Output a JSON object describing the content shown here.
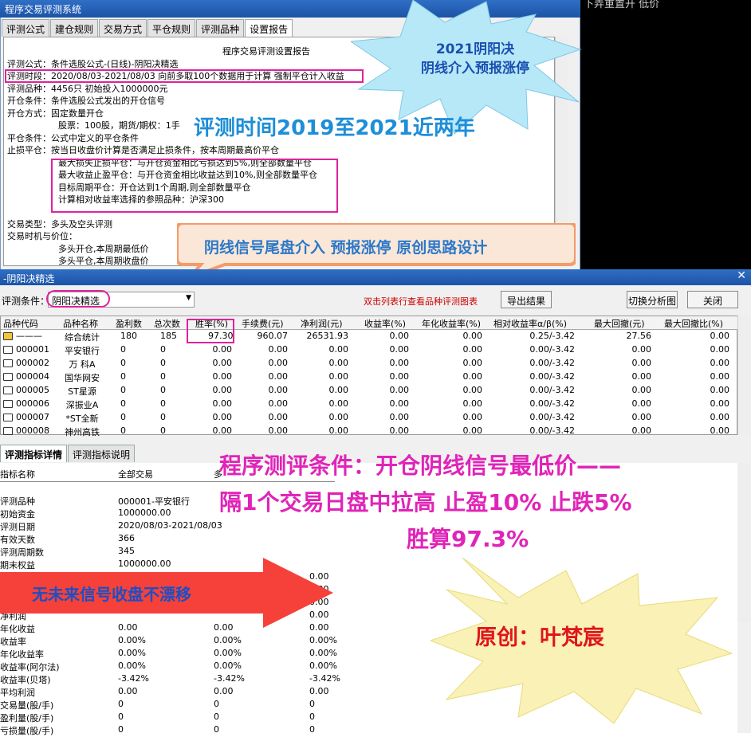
{
  "top_window": {
    "title": "程序交易评测系统",
    "tabs": [
      "评测公式",
      "建仓规则",
      "交易方式",
      "平仓规则",
      "评测品种",
      "设置报告"
    ],
    "report_title": "程序交易评测设置报告",
    "report_lines": [
      "评测公式：条件选股公式-(日线)-阴阳决精选",
      "评测时段：2020/08/03-2021/08/03 向前多取100个数据用于计算 强制平仓计入收益",
      "评测品种：4456只 初始投入1000000元",
      "开仓条件：条件选股公式发出的开仓信号",
      "开仓方式：固定数量开仓",
      "股票：100股，期货/期权：1手",
      "平仓条件：公式中定义的平仓条件",
      "止损平仓：按当日收盘价计算是否满足止损条件，按本周期最高价平仓",
      "最大损失止损平仓：与开仓资金相比亏损达到5%,则全部数量平仓",
      "最大收益止盈平仓：与开仓资金相比收益达到10%,则全部数量平仓",
      "目标周期平仓：开仓达到1个周期,则全部数量平仓",
      "计算相对收益率选择的参照品种：沪深300",
      "交易类型：多头及空头评测",
      "交易时机与价位：",
      "多头开仓,本周期最低价",
      "多头平仓,本周期收盘价"
    ]
  },
  "black_text": "下弄重置开  低价",
  "bottom_window": {
    "title": "-阴阳决精选",
    "cond_label": "评测条件：",
    "cond_value": "阴阳决精选",
    "hint": "双击列表行查看品种评测图表",
    "export_btn": "导出结果",
    "switch_btn": "切换分析图",
    "close_btn": "关闭",
    "columns": [
      "品种代码",
      "品种名称",
      "盈利数",
      "总次数",
      "胜率(%)",
      "手续费(元)",
      "净利润(元)",
      "收益率(%)",
      "年化收益率(%)",
      "相对收益率α/β(%)",
      "最大回撤(元)",
      "最大回撤比(%)"
    ],
    "rows": [
      [
        "———",
        "综合统计",
        "180",
        "185",
        "97.30",
        "960.07",
        "26531.93",
        "0.00",
        "0.00",
        "0.25/-3.42",
        "27.56",
        "0.00"
      ],
      [
        "000001",
        "平安银行",
        "0",
        "0",
        "0.00",
        "0.00",
        "0.00",
        "0.00",
        "0.00",
        "0.00/-3.42",
        "0.00",
        "0.00"
      ],
      [
        "000002",
        "万 科A",
        "0",
        "0",
        "0.00",
        "0.00",
        "0.00",
        "0.00",
        "0.00",
        "0.00/-3.42",
        "0.00",
        "0.00"
      ],
      [
        "000004",
        "国华网安",
        "0",
        "0",
        "0.00",
        "0.00",
        "0.00",
        "0.00",
        "0.00",
        "0.00/-3.42",
        "0.00",
        "0.00"
      ],
      [
        "000005",
        "ST星源",
        "0",
        "0",
        "0.00",
        "0.00",
        "0.00",
        "0.00",
        "0.00",
        "0.00/-3.42",
        "0.00",
        "0.00"
      ],
      [
        "000006",
        "深振业A",
        "0",
        "0",
        "0.00",
        "0.00",
        "0.00",
        "0.00",
        "0.00",
        "0.00/-3.42",
        "0.00",
        "0.00"
      ],
      [
        "000007",
        "*ST全新",
        "0",
        "0",
        "0.00",
        "0.00",
        "0.00",
        "0.00",
        "0.00",
        "0.00/-3.42",
        "0.00",
        "0.00"
      ],
      [
        "000008",
        "神州高铁",
        "0",
        "0",
        "0.00",
        "0.00",
        "0.00",
        "0.00",
        "0.00",
        "0.00/-3.42",
        "0.00",
        "0.00"
      ]
    ],
    "tabs": [
      "评测指标详情",
      "评测指标说明"
    ],
    "detail_headers": [
      "指标名称",
      "全部交易",
      "多"
    ],
    "detail_rows": [
      [
        "评测品种",
        "000001-平安银行",
        "",
        ""
      ],
      [
        "初始资金",
        "1000000.00",
        "",
        ""
      ],
      [
        "评测日期",
        "2020/08/03-2021/08/03",
        "",
        ""
      ],
      [
        "有效天数",
        "366",
        "",
        ""
      ],
      [
        "评测周期数",
        "345",
        "",
        ""
      ],
      [
        "期末权益",
        "1000000.00",
        "",
        ""
      ],
      [
        "",
        "",
        "",
        "0.00"
      ],
      [
        "",
        "",
        "",
        "0.00"
      ],
      [
        "",
        "",
        "",
        "0.00"
      ],
      [
        "净利润",
        "",
        "",
        "0.00"
      ],
      [
        "年化收益",
        "0.00",
        "0.00",
        "0.00"
      ],
      [
        "收益率",
        "0.00%",
        "0.00%",
        "0.00%"
      ],
      [
        "年化收益率",
        "0.00%",
        "0.00%",
        "0.00%"
      ],
      [
        "收益率(阿尔法)",
        "0.00%",
        "0.00%",
        "0.00%"
      ],
      [
        "收益率(贝塔)",
        "-3.42%",
        "-3.42%",
        "-3.42%"
      ],
      [
        "平均利润",
        "0.00",
        "0.00",
        "0.00"
      ],
      [
        "交易量(股/手)",
        "0",
        "0",
        "0"
      ],
      [
        "盈利量(股/手)",
        "0",
        "0",
        "0"
      ],
      [
        "亏损量(股/手)",
        "0",
        "0",
        "0"
      ]
    ]
  },
  "overlays": {
    "star1": "2021阴阳决\n阴线介入预报涨停",
    "headline1": "评测时间2019至2021近两年",
    "banner": "阴线信号尾盘介入 预报涨停 原创思路设计",
    "big_text": [
      "程序测评条件：开仓阴线信号最低价——",
      "隔1个交易日盘中拉高 止盈10% 止跌5%",
      "胜算97.3%"
    ],
    "arrow_text": "无未来信号收盘不漂移",
    "star2": "原创：叶梵宸"
  }
}
